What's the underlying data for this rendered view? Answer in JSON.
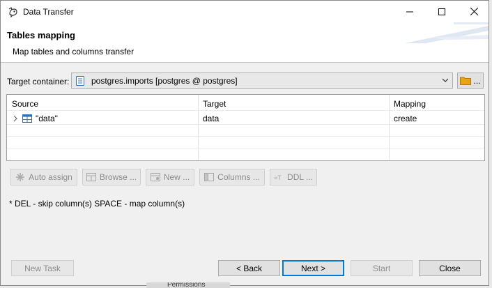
{
  "window": {
    "title": "Data Transfer",
    "controls": {
      "minimize": "minimize-icon",
      "maximize": "maximize-icon",
      "close": "close-icon"
    }
  },
  "header": {
    "title": "Tables mapping",
    "subtitle": "Map tables and columns transfer"
  },
  "target_container": {
    "label": "Target container:",
    "value": "postgres.imports  [postgres @ postgres]",
    "browse_label": "..."
  },
  "table": {
    "columns": [
      "Source",
      "Target",
      "Mapping"
    ],
    "rows": [
      {
        "source": "\"data\"",
        "target": "data",
        "mapping": "create"
      }
    ]
  },
  "actions": {
    "auto_assign": "Auto assign",
    "browse": "Browse ...",
    "new": "New ...",
    "columns": "Columns ...",
    "ddl": "DDL ..."
  },
  "hint": "* DEL - skip column(s)  SPACE - map column(s)",
  "footer": {
    "new_task": "New Task",
    "back": "< Back",
    "next": "Next >",
    "start": "Start",
    "close": "Close"
  },
  "background_text": "Permissions",
  "colors": {
    "accent": "#0078d7",
    "folder": "#e8a317",
    "db_icon": "#2f6fb8"
  }
}
